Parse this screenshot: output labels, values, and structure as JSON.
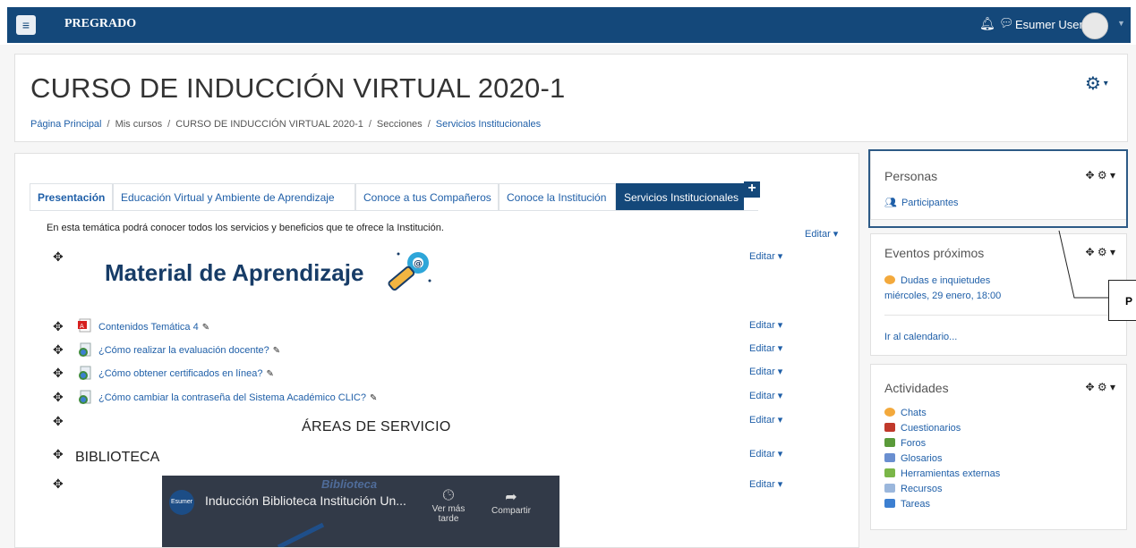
{
  "navbar": {
    "menu_icon": "hamburger-icon",
    "brand": "PREGRADO",
    "user_name": "Esumer User",
    "colors": {
      "bar": "#14487a"
    }
  },
  "header": {
    "course_title": "CURSO DE INDUCCIÓN VIRTUAL 2020-1",
    "breadcrumb": [
      "Página Principal",
      "Mis cursos",
      "CURSO DE INDUCCIÓN VIRTUAL 2020-1",
      "Secciones",
      "Servicios Institucionales"
    ]
  },
  "tabs": [
    {
      "label": "Presentación"
    },
    {
      "label": "Educación Virtual y Ambiente de Aprendizaje"
    },
    {
      "label": "Conoce a tus Compañeros"
    },
    {
      "label": "Conoce la Institución"
    },
    {
      "label": "Servicios Institucionales"
    }
  ],
  "add_tab": "+",
  "content": {
    "intro": "En esta temática podrá conocer todos los servicios y beneficios que te ofrece la Institución.",
    "edit_label": "Editar",
    "material_title": "Material de Aprendizaje",
    "items": [
      {
        "label": "Contenidos Temática 4",
        "icon": "pdf-icon"
      },
      {
        "label": "¿Cómo realizar la evaluación docente?",
        "icon": "page-icon"
      },
      {
        "label": "¿Cómo obtener certificados en línea?",
        "icon": "page-icon"
      },
      {
        "label": "¿Cómo cambiar la contraseña del Sistema Académico CLIC?",
        "icon": "page-icon"
      }
    ],
    "areas_title": "ÁREAS DE SERVICIO",
    "biblioteca": "BIBLIOTECA",
    "video": {
      "title": "Inducción Biblioteca Institución Un...",
      "overlay_word": "Biblioteca",
      "logo_text": "Esumer",
      "later": "Ver más tarde",
      "share": "Compartir"
    }
  },
  "blocks": {
    "personas": {
      "title": "Personas",
      "link": "Participantes"
    },
    "eventos": {
      "title": "Eventos próximos",
      "event_name": "Dudas e inquietudes",
      "event_date": "miércoles, 29 enero, 18:00",
      "calendar_link": "Ir al calendario..."
    },
    "actividades": {
      "title": "Actividades",
      "items": [
        "Chats",
        "Cuestionarios",
        "Foros",
        "Glosarios",
        "Herramientas externas",
        "Recursos",
        "Tareas"
      ]
    }
  },
  "callout": {
    "text": "P"
  }
}
